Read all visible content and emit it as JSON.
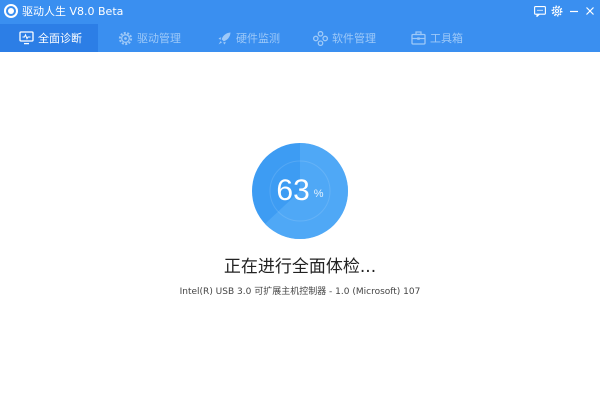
{
  "app": {
    "title": "驱动人生 V8.0 Beta"
  },
  "titlebar": {
    "feedback_icon": "message-icon",
    "settings_icon": "gear-icon",
    "minimize_icon": "minimize-icon",
    "close_icon": "close-icon"
  },
  "tabs": [
    {
      "label": "全面诊断",
      "icon": "monitor-icon",
      "active": true
    },
    {
      "label": "驱动管理",
      "icon": "gear-icon",
      "active": false
    },
    {
      "label": "硬件监测",
      "icon": "rocket-icon",
      "active": false
    },
    {
      "label": "软件管理",
      "icon": "apps-icon",
      "active": false
    },
    {
      "label": "工具箱",
      "icon": "toolbox-icon",
      "active": false
    }
  ],
  "scan": {
    "progress_value": "63",
    "progress_unit": "%",
    "progress_fraction": 0.63,
    "status": "正在进行全面体检...",
    "detail": "Intel(R) USB 3.0 可扩展主机控制器 - 1.0 (Microsoft) 107"
  },
  "colors": {
    "brand": "#3a8ff0",
    "tab_active": "#2c7ee6",
    "ring": "#3d9cf3",
    "ring_light": "#5fb2f7"
  }
}
